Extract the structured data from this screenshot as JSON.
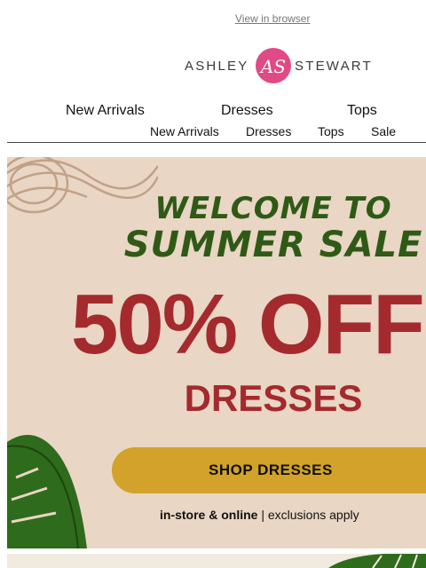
{
  "header": {
    "view_in_browser": "View in browser",
    "logo": {
      "left_text": "ASHLEY",
      "right_text": "STEWART",
      "monogram": "AS",
      "brand_color": "#e04a86"
    }
  },
  "nav_primary": [
    "New Arrivals",
    "Dresses",
    "Tops"
  ],
  "nav_secondary": [
    "New Arrivals",
    "Dresses",
    "Tops",
    "Sale"
  ],
  "hero": {
    "headline_1": "WELCOME TO",
    "headline_2": "SUMMER SALE",
    "discount": "50% OFF",
    "category": "DRESSES",
    "cta_label": "SHOP DRESSES",
    "footnote_bold": "in-store & online",
    "footnote_sep": " | ",
    "footnote_rest": "exclusions apply",
    "colors": {
      "background": "#e9d6c5",
      "headline": "#2f5a16",
      "discount": "#a42a2e",
      "button": "#d3a22a"
    }
  }
}
